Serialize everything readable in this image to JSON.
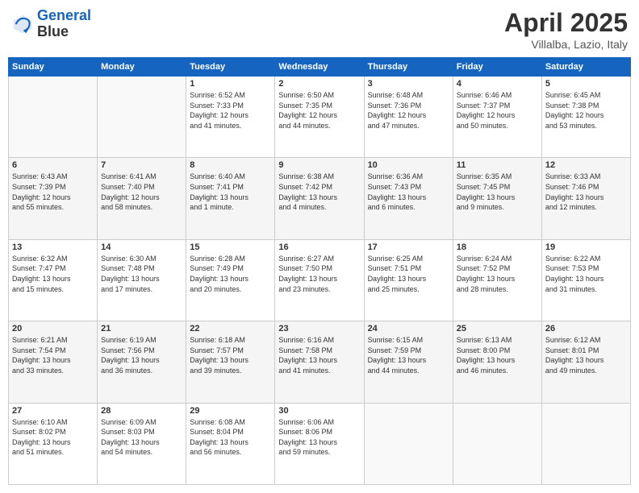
{
  "logo": {
    "line1": "General",
    "line2": "Blue"
  },
  "header": {
    "month": "April 2025",
    "location": "Villalba, Lazio, Italy"
  },
  "weekdays": [
    "Sunday",
    "Monday",
    "Tuesday",
    "Wednesday",
    "Thursday",
    "Friday",
    "Saturday"
  ],
  "weeks": [
    [
      {
        "day": "",
        "info": ""
      },
      {
        "day": "",
        "info": ""
      },
      {
        "day": "1",
        "info": "Sunrise: 6:52 AM\nSunset: 7:33 PM\nDaylight: 12 hours\nand 41 minutes."
      },
      {
        "day": "2",
        "info": "Sunrise: 6:50 AM\nSunset: 7:35 PM\nDaylight: 12 hours\nand 44 minutes."
      },
      {
        "day": "3",
        "info": "Sunrise: 6:48 AM\nSunset: 7:36 PM\nDaylight: 12 hours\nand 47 minutes."
      },
      {
        "day": "4",
        "info": "Sunrise: 6:46 AM\nSunset: 7:37 PM\nDaylight: 12 hours\nand 50 minutes."
      },
      {
        "day": "5",
        "info": "Sunrise: 6:45 AM\nSunset: 7:38 PM\nDaylight: 12 hours\nand 53 minutes."
      }
    ],
    [
      {
        "day": "6",
        "info": "Sunrise: 6:43 AM\nSunset: 7:39 PM\nDaylight: 12 hours\nand 55 minutes."
      },
      {
        "day": "7",
        "info": "Sunrise: 6:41 AM\nSunset: 7:40 PM\nDaylight: 12 hours\nand 58 minutes."
      },
      {
        "day": "8",
        "info": "Sunrise: 6:40 AM\nSunset: 7:41 PM\nDaylight: 13 hours\nand 1 minute."
      },
      {
        "day": "9",
        "info": "Sunrise: 6:38 AM\nSunset: 7:42 PM\nDaylight: 13 hours\nand 4 minutes."
      },
      {
        "day": "10",
        "info": "Sunrise: 6:36 AM\nSunset: 7:43 PM\nDaylight: 13 hours\nand 6 minutes."
      },
      {
        "day": "11",
        "info": "Sunrise: 6:35 AM\nSunset: 7:45 PM\nDaylight: 13 hours\nand 9 minutes."
      },
      {
        "day": "12",
        "info": "Sunrise: 6:33 AM\nSunset: 7:46 PM\nDaylight: 13 hours\nand 12 minutes."
      }
    ],
    [
      {
        "day": "13",
        "info": "Sunrise: 6:32 AM\nSunset: 7:47 PM\nDaylight: 13 hours\nand 15 minutes."
      },
      {
        "day": "14",
        "info": "Sunrise: 6:30 AM\nSunset: 7:48 PM\nDaylight: 13 hours\nand 17 minutes."
      },
      {
        "day": "15",
        "info": "Sunrise: 6:28 AM\nSunset: 7:49 PM\nDaylight: 13 hours\nand 20 minutes."
      },
      {
        "day": "16",
        "info": "Sunrise: 6:27 AM\nSunset: 7:50 PM\nDaylight: 13 hours\nand 23 minutes."
      },
      {
        "day": "17",
        "info": "Sunrise: 6:25 AM\nSunset: 7:51 PM\nDaylight: 13 hours\nand 25 minutes."
      },
      {
        "day": "18",
        "info": "Sunrise: 6:24 AM\nSunset: 7:52 PM\nDaylight: 13 hours\nand 28 minutes."
      },
      {
        "day": "19",
        "info": "Sunrise: 6:22 AM\nSunset: 7:53 PM\nDaylight: 13 hours\nand 31 minutes."
      }
    ],
    [
      {
        "day": "20",
        "info": "Sunrise: 6:21 AM\nSunset: 7:54 PM\nDaylight: 13 hours\nand 33 minutes."
      },
      {
        "day": "21",
        "info": "Sunrise: 6:19 AM\nSunset: 7:56 PM\nDaylight: 13 hours\nand 36 minutes."
      },
      {
        "day": "22",
        "info": "Sunrise: 6:18 AM\nSunset: 7:57 PM\nDaylight: 13 hours\nand 39 minutes."
      },
      {
        "day": "23",
        "info": "Sunrise: 6:16 AM\nSunset: 7:58 PM\nDaylight: 13 hours\nand 41 minutes."
      },
      {
        "day": "24",
        "info": "Sunrise: 6:15 AM\nSunset: 7:59 PM\nDaylight: 13 hours\nand 44 minutes."
      },
      {
        "day": "25",
        "info": "Sunrise: 6:13 AM\nSunset: 8:00 PM\nDaylight: 13 hours\nand 46 minutes."
      },
      {
        "day": "26",
        "info": "Sunrise: 6:12 AM\nSunset: 8:01 PM\nDaylight: 13 hours\nand 49 minutes."
      }
    ],
    [
      {
        "day": "27",
        "info": "Sunrise: 6:10 AM\nSunset: 8:02 PM\nDaylight: 13 hours\nand 51 minutes."
      },
      {
        "day": "28",
        "info": "Sunrise: 6:09 AM\nSunset: 8:03 PM\nDaylight: 13 hours\nand 54 minutes."
      },
      {
        "day": "29",
        "info": "Sunrise: 6:08 AM\nSunset: 8:04 PM\nDaylight: 13 hours\nand 56 minutes."
      },
      {
        "day": "30",
        "info": "Sunrise: 6:06 AM\nSunset: 8:06 PM\nDaylight: 13 hours\nand 59 minutes."
      },
      {
        "day": "",
        "info": ""
      },
      {
        "day": "",
        "info": ""
      },
      {
        "day": "",
        "info": ""
      }
    ]
  ]
}
